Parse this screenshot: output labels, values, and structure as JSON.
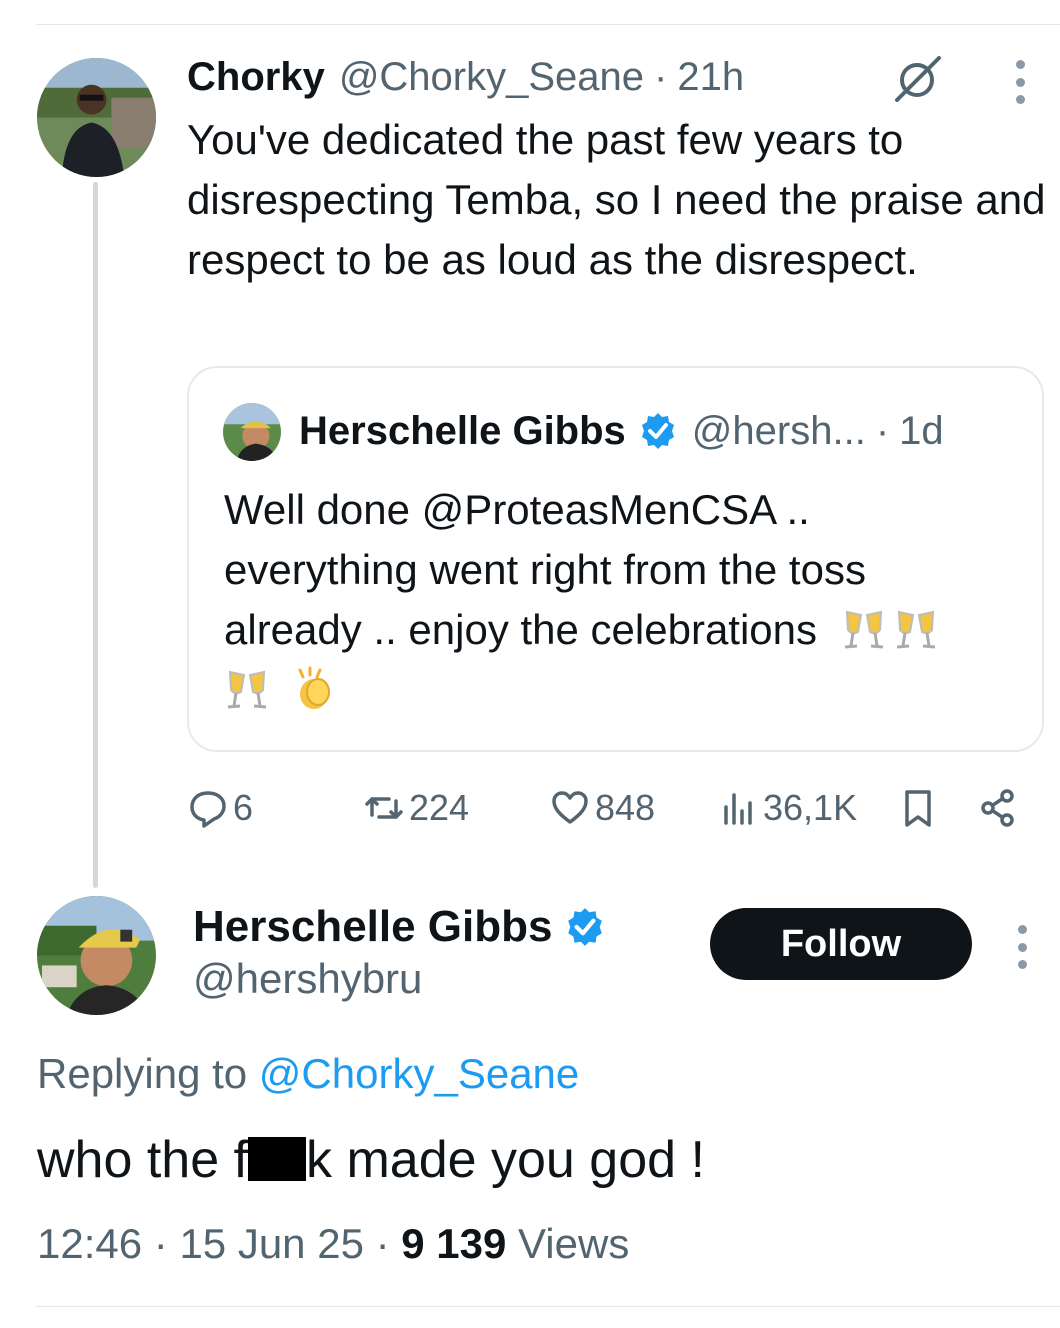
{
  "parent_tweet": {
    "author_name": "Chorky",
    "author_handle": "@Chorky_Seane",
    "time": "21h",
    "text": "You've dedicated the past few years to disrespecting Temba, so I need the praise and respect to be as loud as the disrespect.",
    "quote": {
      "author_name": "Herschelle Gibbs",
      "author_handle": "@hersh...",
      "time": "1d",
      "text": "Well done @ProteasMenCSA .. everything went right from the toss already .. enjoy the celebrations",
      "emojis": [
        "clinking-glasses",
        "clinking-glasses",
        "clinking-glasses",
        "clapping-hands"
      ]
    },
    "stats": {
      "replies": "6",
      "reposts": "224",
      "likes": "848",
      "views": "36,1K"
    }
  },
  "main_tweet": {
    "author_name": "Herschelle Gibbs",
    "author_handle": "@hershybru",
    "follow_label": "Follow",
    "replying_prefix": "Replying to",
    "replying_handle": "@Chorky_Seane",
    "text_before": "who the f",
    "text_after": "k made you god !",
    "time": "12:46",
    "date": "15 Jun 25",
    "views_count": "9 139",
    "views_label": "Views"
  },
  "colors": {
    "text": "#0f1419",
    "secondary": "#536471",
    "link": "#1d9bf0",
    "verified": "#1d9bf0",
    "border": "#e7e9ea"
  }
}
